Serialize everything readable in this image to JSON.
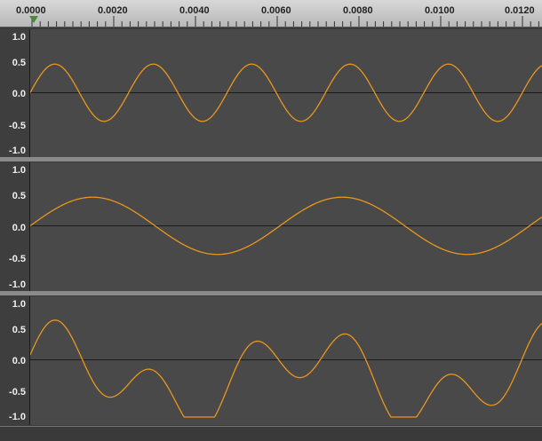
{
  "ruler": {
    "labels": [
      "0.0000",
      "0.0020",
      "0.0040",
      "0.0060",
      "0.0080",
      "0.0100",
      "0.0120"
    ]
  },
  "tracks": [
    {
      "labels": [
        "1.0",
        "0.5",
        "0.0",
        "-0.5",
        "-1.0"
      ],
      "waveform": "sine, 5.2 cycles, amplitude 0.5"
    },
    {
      "labels": [
        "1.0",
        "0.5",
        "0.0",
        "-0.5",
        "-1.0"
      ],
      "waveform": "sine, 2.05 cycles, amplitude 0.5"
    },
    {
      "labels": [
        "1.0",
        "0.5",
        "0.0",
        "-0.5",
        "-1.0"
      ],
      "waveform": "sum of two sines"
    }
  ],
  "colors": {
    "waveform": "#e8961e",
    "track_bg": "#494949",
    "zero_line": "#1a1a1a"
  }
}
